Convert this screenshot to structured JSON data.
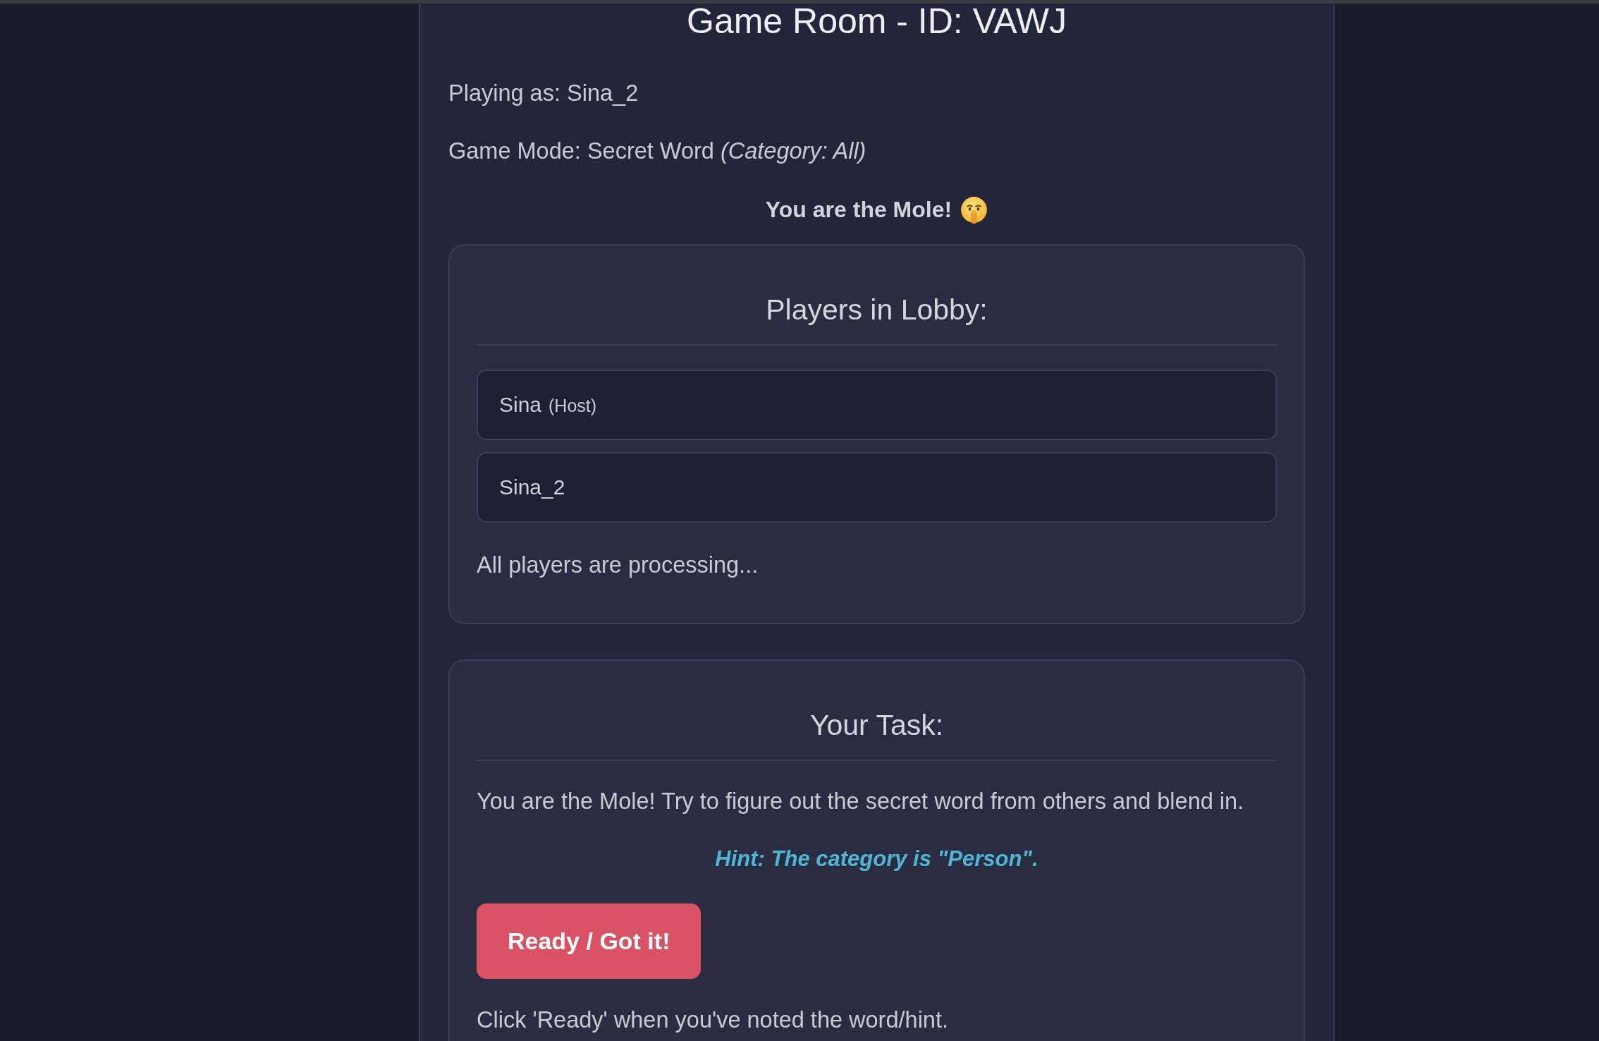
{
  "room_title": "Game Room - ID: VAWJ",
  "playing_as": "Playing as: Sina_2",
  "game_mode": "Game Mode: Secret Word *(Category: All)*",
  "role_banner": "You are the Mole!",
  "lobby": {
    "title": "Players in Lobby:",
    "players": [
      {
        "name": "Sina",
        "tag": "(Host)"
      },
      {
        "name": "Sina_2"
      }
    ],
    "status": "All players are processing..."
  },
  "task": {
    "title": "Your Task:",
    "description": "You are the Mole! Try to figure out the secret word from others and blend in.",
    "hint": "Hint: The category is \"Person\".",
    "button": "Ready / Got it!",
    "note": "Click 'Ready' when you've noted the word/hint."
  }
}
